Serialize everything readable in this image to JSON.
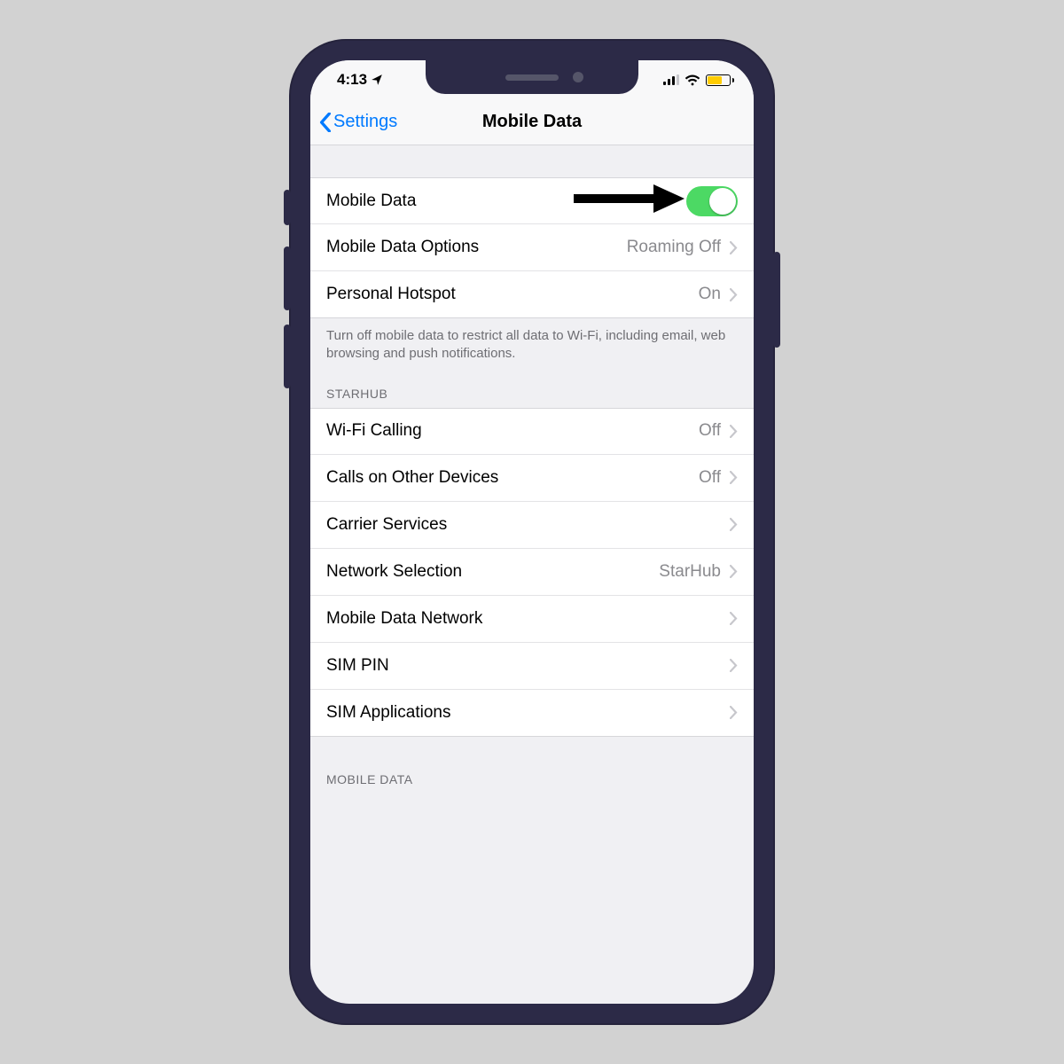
{
  "status": {
    "time": "4:13",
    "location_icon": "location-arrow",
    "signal_icon": "cellular-signal",
    "wifi_icon": "wifi",
    "battery_icon": "battery-low-power"
  },
  "nav": {
    "back_label": "Settings",
    "title": "Mobile Data"
  },
  "group1": {
    "mobile_data": {
      "label": "Mobile Data",
      "state": "on"
    },
    "options": {
      "label": "Mobile Data Options",
      "value": "Roaming Off"
    },
    "hotspot": {
      "label": "Personal Hotspot",
      "value": "On"
    },
    "footer": "Turn off mobile data to restrict all data to Wi-Fi, including email, web browsing and push notifications."
  },
  "group2": {
    "header": "STARHUB",
    "rows": [
      {
        "label": "Wi-Fi Calling",
        "value": "Off"
      },
      {
        "label": "Calls on Other Devices",
        "value": "Off"
      },
      {
        "label": "Carrier Services",
        "value": ""
      },
      {
        "label": "Network Selection",
        "value": "StarHub"
      },
      {
        "label": "Mobile Data Network",
        "value": ""
      },
      {
        "label": "SIM PIN",
        "value": ""
      },
      {
        "label": "SIM Applications",
        "value": ""
      }
    ]
  },
  "group3": {
    "header": "MOBILE DATA"
  },
  "annotation": {
    "arrow_points_to": "mobile-data-toggle"
  }
}
